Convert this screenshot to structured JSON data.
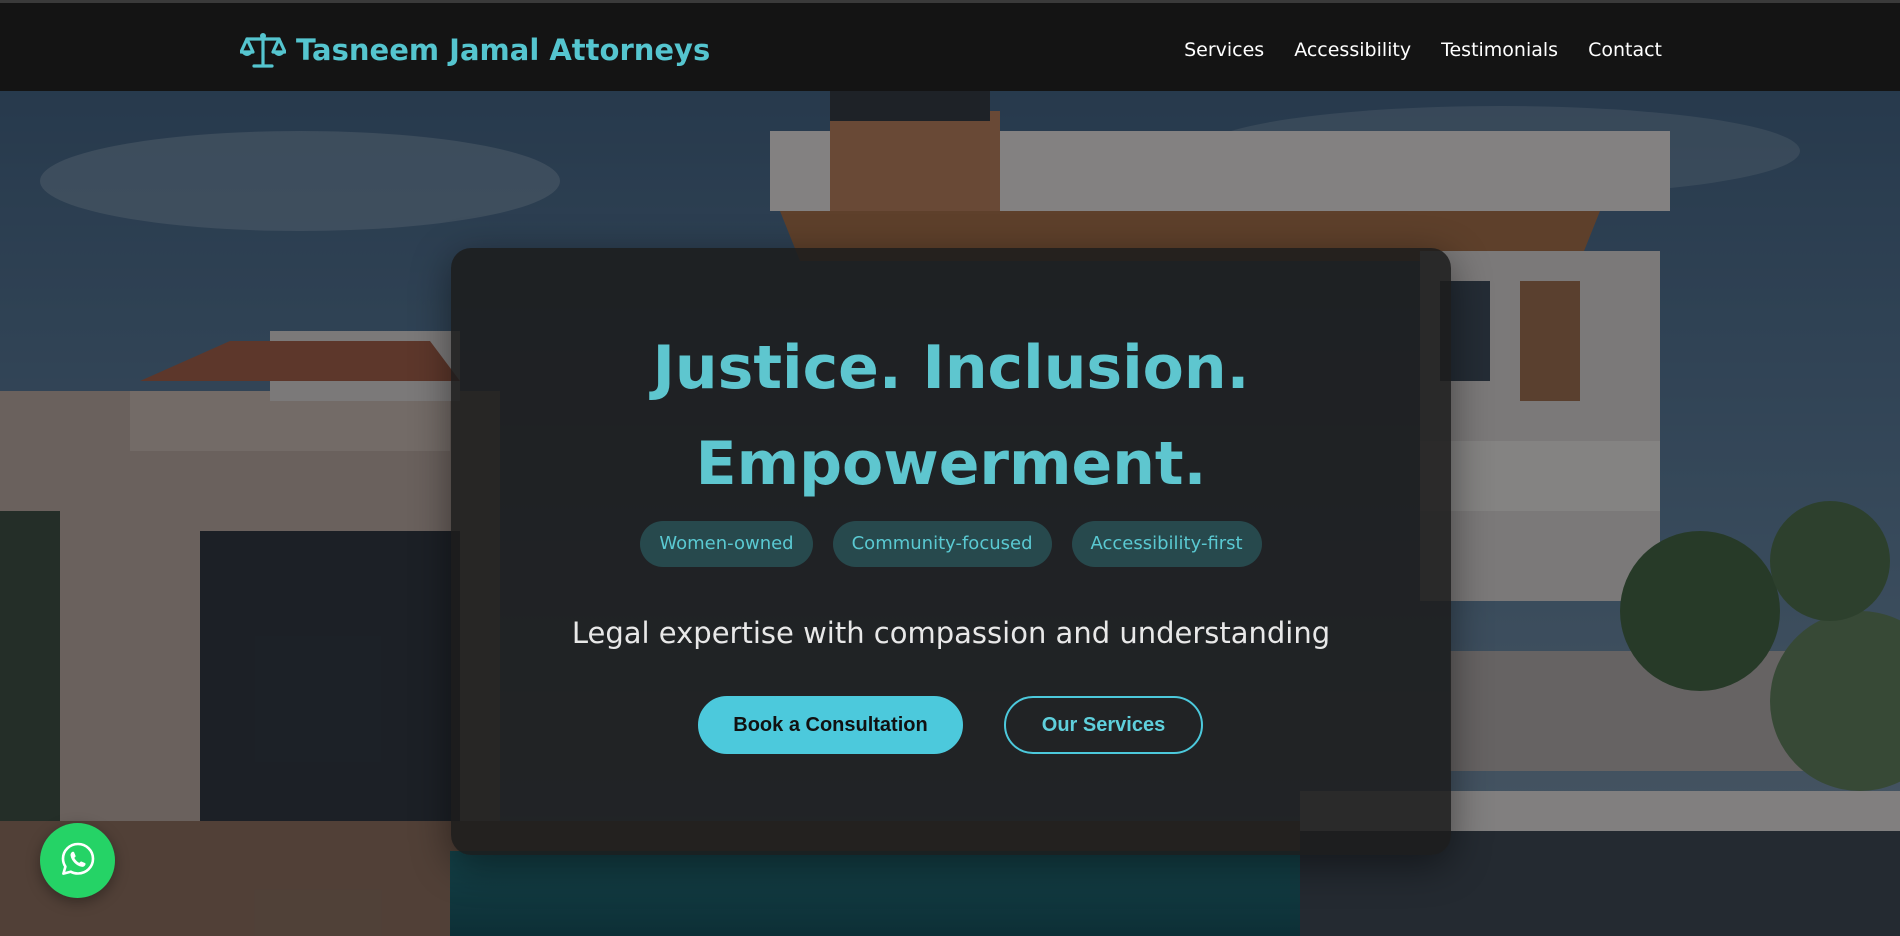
{
  "header": {
    "brand_name": "Tasneem Jamal Attorneys",
    "logo_icon": "scales-of-justice-icon",
    "nav": [
      {
        "label": "Services"
      },
      {
        "label": "Accessibility"
      },
      {
        "label": "Testimonials"
      },
      {
        "label": "Contact"
      }
    ]
  },
  "hero": {
    "headline_line1": "Justice. Inclusion.",
    "headline_line2": "Empowerment.",
    "pills": [
      {
        "label": "Women-owned"
      },
      {
        "label": "Community-focused"
      },
      {
        "label": "Accessibility-first"
      }
    ],
    "tagline": "Legal expertise with compassion and understanding",
    "primary_button": "Book a Consultation",
    "secondary_button": "Our Services"
  },
  "fab": {
    "icon": "whatsapp-icon"
  },
  "colors": {
    "accent": "#5ec6cf",
    "button_primary": "#4cc9dc",
    "header_bg": "#141414",
    "whatsapp_green": "#25d366"
  }
}
